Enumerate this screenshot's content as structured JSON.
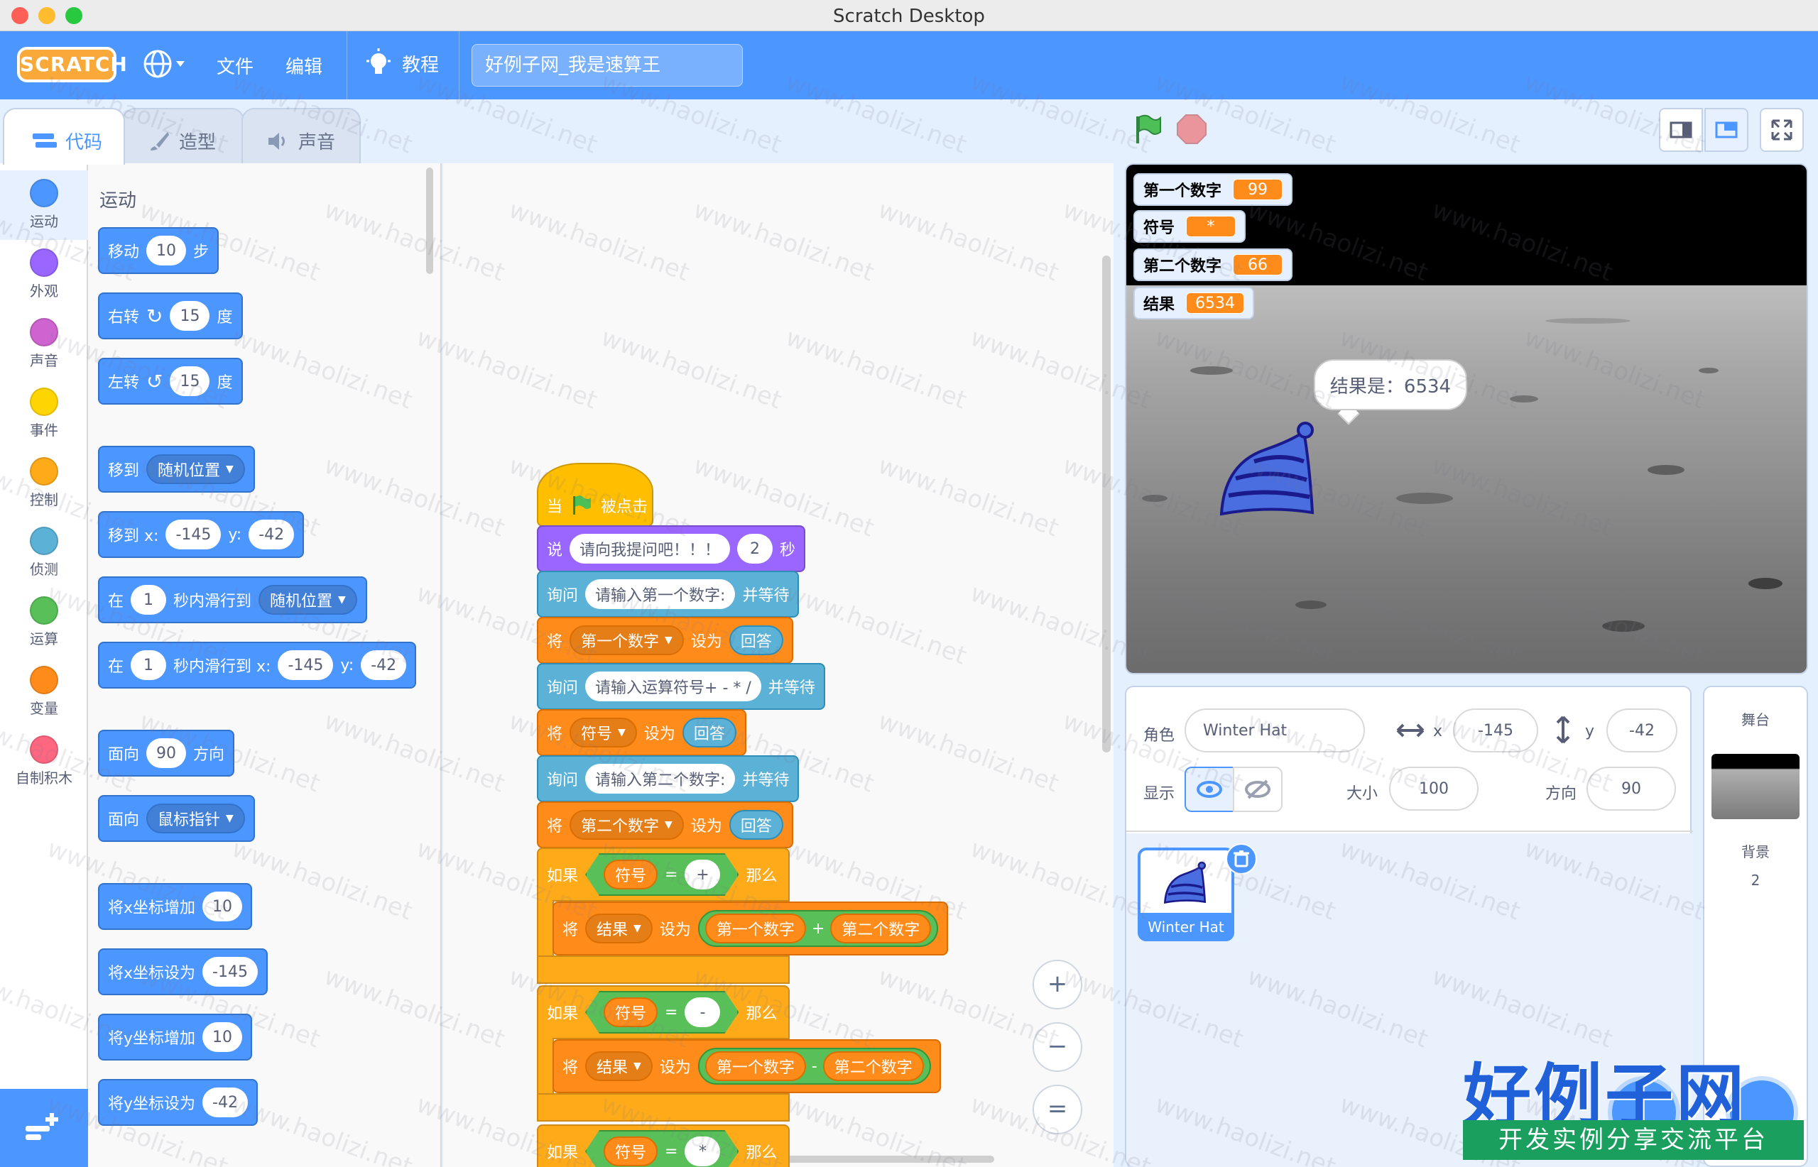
{
  "window": {
    "title": "Scratch Desktop"
  },
  "menu": {
    "logo": "SCRATCH",
    "file": "文件",
    "edit": "编辑",
    "tutorials": "教程",
    "project_title": "好例子网_我是速算王"
  },
  "tabs": {
    "code": "代码",
    "costumes": "造型",
    "sounds": "声音"
  },
  "categories": [
    {
      "label": "运动",
      "color": "#4c97ff"
    },
    {
      "label": "外观",
      "color": "#9966ff"
    },
    {
      "label": "声音",
      "color": "#cf63cf"
    },
    {
      "label": "事件",
      "color": "#ffd500"
    },
    {
      "label": "控制",
      "color": "#ffab19"
    },
    {
      "label": "侦测",
      "color": "#5cb1d6"
    },
    {
      "label": "运算",
      "color": "#59c059"
    },
    {
      "label": "变量",
      "color": "#ff8c1a"
    },
    {
      "label": "自制积木",
      "color": "#ff6680"
    }
  ],
  "palette": {
    "heading": "运动",
    "move": {
      "a": "移动",
      "n": "10",
      "b": "步"
    },
    "turn_right": {
      "a": "右转",
      "n": "15",
      "b": "度"
    },
    "turn_left": {
      "a": "左转",
      "n": "15",
      "b": "度"
    },
    "goto": {
      "a": "移到",
      "dd": "随机位置"
    },
    "goto_xy": {
      "a": "移到 x:",
      "x": "-145",
      "y_label": "y:",
      "y": "-42"
    },
    "glide": {
      "a": "在",
      "n": "1",
      "b": "秒内滑行到",
      "dd": "随机位置"
    },
    "glide_xy": {
      "a": "在",
      "n": "1",
      "b": "秒内滑行到 x:",
      "x": "-145",
      "y_label": "y:",
      "y": "-42"
    },
    "point_dir": {
      "a": "面向",
      "n": "90",
      "b": "方向"
    },
    "point_towards": {
      "a": "面向",
      "dd": "鼠标指针"
    },
    "change_x": {
      "a": "将x坐标增加",
      "n": "10"
    },
    "set_x": {
      "a": "将x坐标设为",
      "n": "-145"
    },
    "change_y": {
      "a": "将y坐标增加",
      "n": "10"
    },
    "set_y": {
      "a": "将y坐标设为",
      "n": "-42"
    }
  },
  "script": {
    "hat": {
      "a": "当",
      "b": "被点击"
    },
    "say": {
      "a": "说",
      "msg": "请向我提问吧！！！",
      "n": "2",
      "b": "秒"
    },
    "ask1": {
      "a": "询问",
      "q": "请输入第一个数字:",
      "b": "并等待"
    },
    "set1": {
      "a": "将",
      "var": "第一个数字",
      "b": "设为",
      "val": "回答"
    },
    "ask2": {
      "a": "询问",
      "q": "请输入运算符号+ - * /",
      "b": "并等待"
    },
    "set2": {
      "a": "将",
      "var": "符号",
      "b": "设为",
      "val": "回答"
    },
    "ask3": {
      "a": "询问",
      "q": "请输入第二个数字:",
      "b": "并等待"
    },
    "set3": {
      "a": "将",
      "var": "第二个数字",
      "b": "设为",
      "val": "回答"
    },
    "if1": {
      "a": "如果",
      "var": "符号",
      "eq": "=",
      "sym": "+",
      "b": "那么"
    },
    "set_r1": {
      "a": "将",
      "var": "结果",
      "b": "设为",
      "l": "第一个数字",
      "op": "+",
      "r": "第二个数字"
    },
    "if2": {
      "a": "如果",
      "var": "符号",
      "eq": "=",
      "sym": "-",
      "b": "那么"
    },
    "set_r2": {
      "a": "将",
      "var": "结果",
      "b": "设为",
      "l": "第一个数字",
      "op": "-",
      "r": "第二个数字"
    },
    "if3": {
      "a": "如果",
      "var": "符号",
      "eq": "=",
      "sym": "*",
      "b": "那么"
    }
  },
  "zoom": {
    "in": "+",
    "out": "−",
    "reset": "="
  },
  "stage": {
    "monitors": [
      {
        "label": "第一个数字",
        "value": "99"
      },
      {
        "label": "符号",
        "value": "*"
      },
      {
        "label": "第二个数字",
        "value": "66"
      },
      {
        "label": "结果",
        "value": "6534"
      }
    ],
    "bubble": "结果是：6534"
  },
  "sprite": {
    "label_sprite": "角色",
    "name": "Winter Hat",
    "x_label": "x",
    "x": "-145",
    "y_label": "y",
    "y": "-42",
    "show_label": "显示",
    "size_label": "大小",
    "size": "100",
    "dir_label": "方向",
    "dir": "90",
    "thumb_name": "Winter Hat"
  },
  "stage_panel": {
    "title": "舞台",
    "backdrop_label": "背景",
    "backdrop_count": "2"
  },
  "watermark": {
    "text": "www.haolizi.net",
    "brand": "好例子网",
    "brand_sub": "开发实例分享交流平台"
  }
}
